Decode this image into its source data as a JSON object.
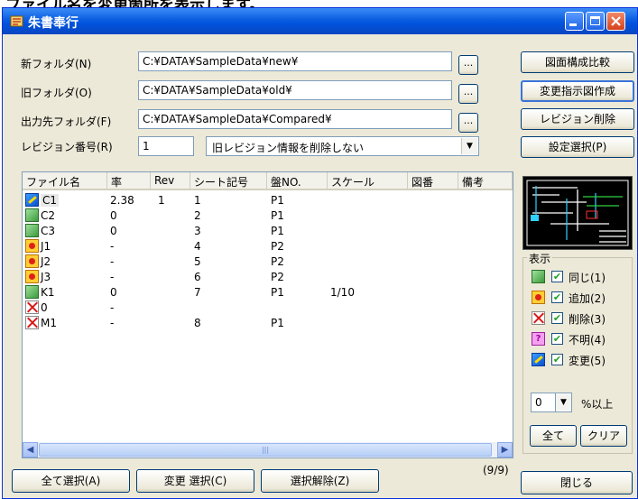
{
  "window": {
    "title": "朱書奉行",
    "background_caption": "ファイル名を変更箇所を表示します。"
  },
  "folders": {
    "new_label": "新フォルダ(N)",
    "new_value": "C:¥DATA¥SampleData¥new¥",
    "old_label": "旧フォルダ(O)",
    "old_value": "C:¥DATA¥SampleData¥old¥",
    "output_label": "出力先フォルダ(F)",
    "output_value": "C:¥DATA¥SampleData¥Compared¥",
    "browse_label": "..."
  },
  "revision": {
    "label": "レビジョン番号(R)",
    "value": "1",
    "option_selected": "旧レビジョン情報を削除しない"
  },
  "side_buttons": {
    "compare": "図面構成比較",
    "make_instruction": "変更指示図作成",
    "delete_revision": "レビジョン削除",
    "select_settings": "設定選択(P)"
  },
  "table": {
    "columns": [
      "ファイル名",
      "率",
      "Rev",
      "シート記号",
      "盤NO.",
      "スケール",
      "図番",
      "備考"
    ],
    "rows": [
      {
        "icon": "changed-icon",
        "name": "C1",
        "rate": "2.38",
        "rev": "1",
        "sheet": "1",
        "panel": "P1",
        "scale": ""
      },
      {
        "icon": "same-icon",
        "name": "C2",
        "rate": "0",
        "rev": "",
        "sheet": "2",
        "panel": "P1",
        "scale": ""
      },
      {
        "icon": "same-icon",
        "name": "C3",
        "rate": "0",
        "rev": "",
        "sheet": "3",
        "panel": "P1",
        "scale": ""
      },
      {
        "icon": "added-icon",
        "name": "J1",
        "rate": "-",
        "rev": "",
        "sheet": "4",
        "panel": "P2",
        "scale": ""
      },
      {
        "icon": "added-icon",
        "name": "J2",
        "rate": "-",
        "rev": "",
        "sheet": "5",
        "panel": "P2",
        "scale": ""
      },
      {
        "icon": "added-icon",
        "name": "J3",
        "rate": "-",
        "rev": "",
        "sheet": "6",
        "panel": "P2",
        "scale": ""
      },
      {
        "icon": "same-icon",
        "name": "K1",
        "rate": "0",
        "rev": "",
        "sheet": "7",
        "panel": "P1",
        "scale": "1/10"
      },
      {
        "icon": "deleted-icon",
        "name": "0",
        "rate": "-",
        "rev": "",
        "sheet": "",
        "panel": "",
        "scale": ""
      },
      {
        "icon": "deleted-icon",
        "name": "M1",
        "rate": "-",
        "rev": "",
        "sheet": "8",
        "panel": "P1",
        "scale": ""
      }
    ]
  },
  "legend": {
    "title": "表示",
    "items": [
      {
        "icon": "same-icon",
        "label": "同じ(1)",
        "checked": true
      },
      {
        "icon": "added-icon",
        "label": "追加(2)",
        "checked": true
      },
      {
        "icon": "deleted-icon",
        "label": "削除(3)",
        "checked": true
      },
      {
        "icon": "unknown-icon",
        "label": "不明(4)",
        "checked": true
      },
      {
        "icon": "changed-icon",
        "label": "変更(5)",
        "checked": true
      }
    ],
    "threshold_value": "0",
    "threshold_suffix": "%以上",
    "all_button": "全て",
    "clear_button": "クリア"
  },
  "bottom": {
    "select_all": "全て選択(A)",
    "select_changed": "変更 選択(C)",
    "deselect": "選択解除(Z)",
    "count": "(9/9)",
    "close": "閉じる"
  },
  "colors": {
    "title_bar": "#0a5de0",
    "face": "#ece9d8",
    "check": "#21a121"
  }
}
